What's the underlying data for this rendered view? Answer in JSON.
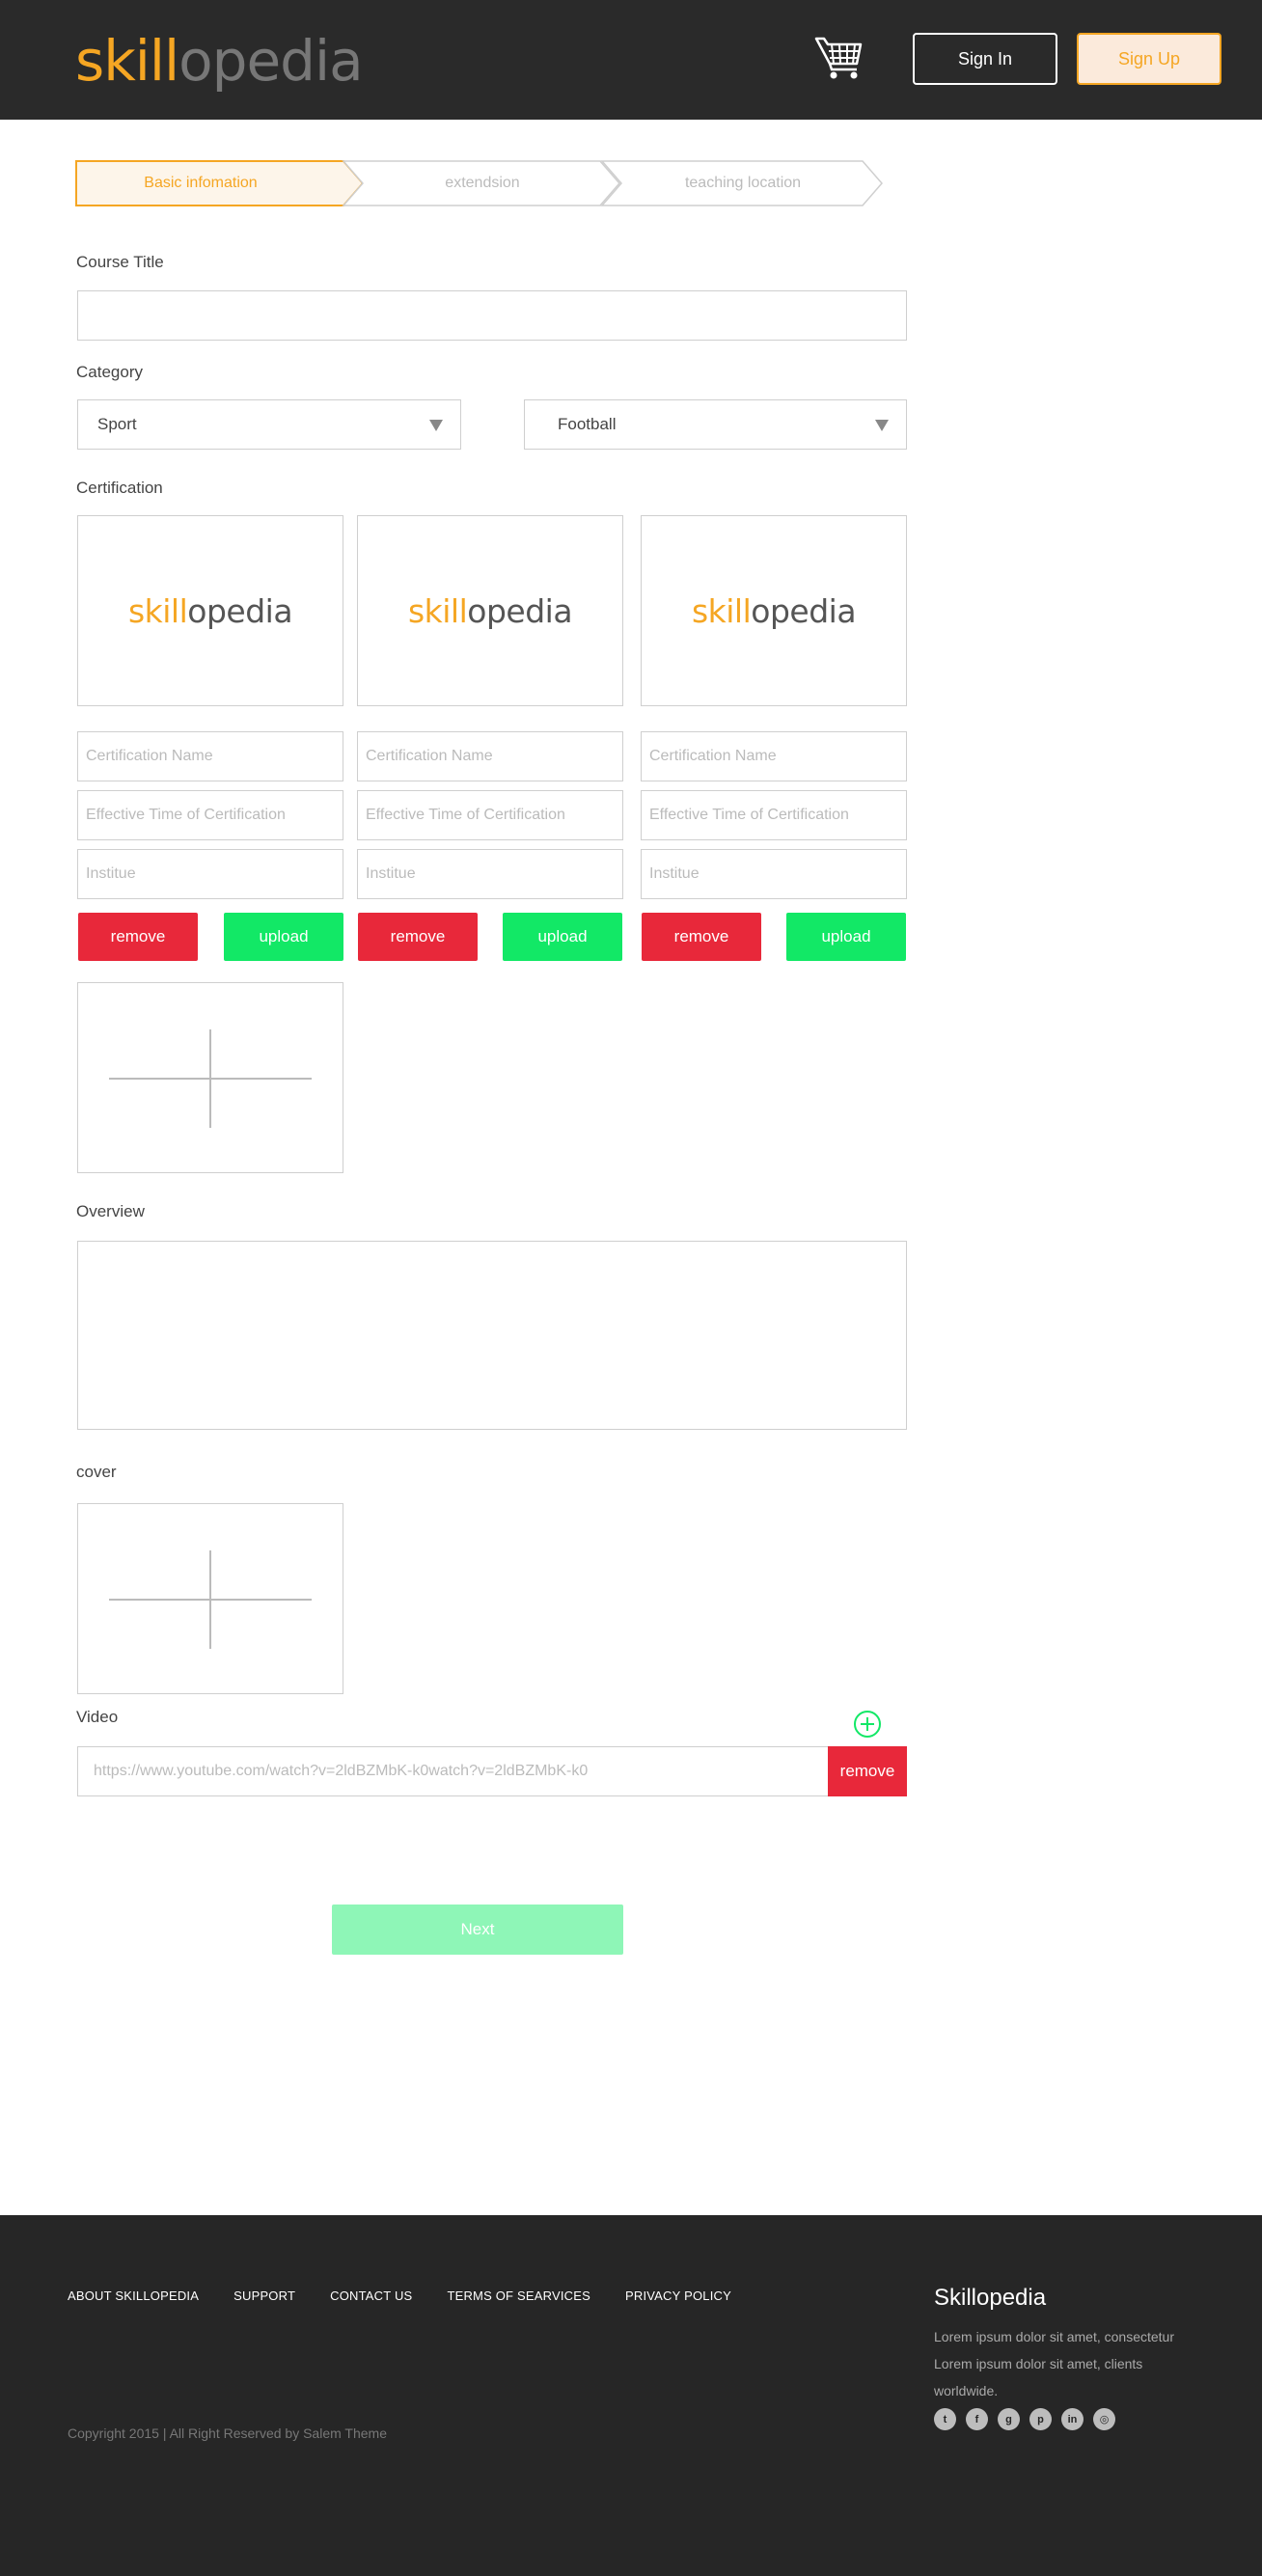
{
  "header": {
    "logo_part1": "skill",
    "logo_part2": "opedia",
    "sign_in": "Sign In",
    "sign_up": "Sign Up"
  },
  "steps": [
    {
      "label": "Basic infomation",
      "active": true
    },
    {
      "label": "extendsion",
      "active": false
    },
    {
      "label": "teaching location",
      "active": false
    }
  ],
  "form": {
    "course_title_label": "Course Title",
    "course_title_value": "",
    "category_label": "Category",
    "category_primary": "Sport",
    "category_secondary": "Football",
    "certification_label": "Certification",
    "certifications": [
      {
        "logo_part1": "skill",
        "logo_part2": "opedia",
        "name_placeholder": "Certification Name",
        "time_placeholder": "Effective Time of Certification",
        "institute_placeholder": "Institue",
        "remove_label": "remove",
        "upload_label": "upload"
      },
      {
        "logo_part1": "skill",
        "logo_part2": "opedia",
        "name_placeholder": "Certification Name",
        "time_placeholder": "Effective Time of Certification",
        "institute_placeholder": "Institue",
        "remove_label": "remove",
        "upload_label": "upload"
      },
      {
        "logo_part1": "skill",
        "logo_part2": "opedia",
        "name_placeholder": "Certification Name",
        "time_placeholder": "Effective Time of Certification",
        "institute_placeholder": "Institue",
        "remove_label": "remove",
        "upload_label": "upload"
      }
    ],
    "overview_label": "Overview",
    "cover_label": "cover",
    "video_label": "Video",
    "video_placeholder": "https://www.youtube.com/watch?v=2ldBZMbK-k0watch?v=2ldBZMbK-k0",
    "video_remove_label": "remove",
    "next_label": "Next"
  },
  "footer": {
    "nav": [
      "ABOUT SKILLOPEDIA",
      "SUPPORT",
      "CONTACT US",
      "TERMS OF SEARVICES",
      "PRIVACY POLICY"
    ],
    "copyright": "Copyright 2015 | All Right Reserved by Salem Theme",
    "brand_title": "Skillopedia",
    "brand_desc": "Lorem ipsum dolor sit amet, consectetur Lorem ipsum dolor sit amet,  clients worldwide.",
    "social_icons": [
      "twitter-icon",
      "facebook-icon",
      "google-plus-icon",
      "pinterest-icon",
      "linkedin-icon",
      "dribbble-icon"
    ]
  },
  "colors": {
    "brand_orange": "#f5a623",
    "remove_red": "#e8283a",
    "upload_green": "#12e866",
    "next_green": "#8ef6b7",
    "dark_bg": "#2a2a2a"
  }
}
